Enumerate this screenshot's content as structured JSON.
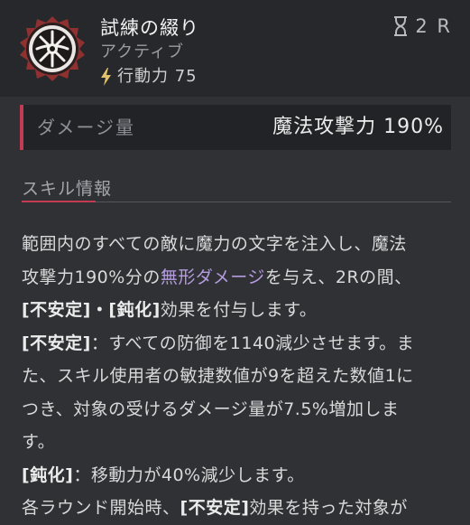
{
  "skill": {
    "name": "試練の綴り",
    "type": "アクティブ",
    "cost": "行動力 75",
    "cooldown": "2 R"
  },
  "damage": {
    "label": "ダメージ量",
    "value": "魔法攻撃力 190%"
  },
  "section": {
    "title": "スキル情報"
  },
  "description": {
    "l1": "範囲内のすべての敵に魔力の文字を注入し、魔法",
    "l2a": "攻撃力190%分の",
    "l2kw": "無形ダメージ",
    "l2b": "を与え、2Rの間、",
    "l3a": "[不安定]",
    "l3b": "・",
    "l3c": "[鈍化]",
    "l3d": "効果を付与します。",
    "l4a": "[不安定]",
    "l4b": "：すべての防御を1140減少させます。ま",
    "l5": "た、スキル使用者の敏捷数値が9を超えた数値1に",
    "l6": "つき、対象の受けるダメージ量が7.5%増加しま",
    "l7": "す。",
    "l8a": "[鈍化]",
    "l8b": "：移動力が40%減少します。",
    "l9a": "各ラウンド開始時、",
    "l9b": "[不安定]",
    "l9c": "効果を持った対象が"
  },
  "colors": {
    "accent": "#c23b53",
    "keyword": "#b69be0",
    "icon_ring": "#a83a3a"
  }
}
